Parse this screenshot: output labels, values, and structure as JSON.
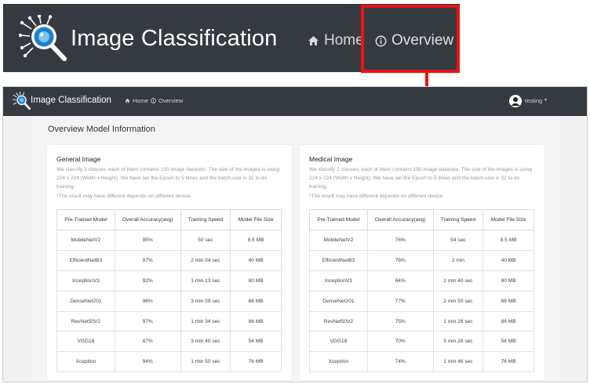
{
  "banner": {
    "title": "Image Classification",
    "nav_home": "Home",
    "nav_overview": "Overview"
  },
  "topbar": {
    "title": "Image Classification",
    "nav_home": "Home",
    "nav_overview": "Overview",
    "username": "testing"
  },
  "page": {
    "title": "Overview Model Information"
  },
  "columns": [
    "Pre-Trained Model",
    "Overall Accuracy(avg)",
    "Training Speed",
    "Model File Size"
  ],
  "general": {
    "title": "General Image",
    "desc": "We classify 2 classes, each of them contains 150 image datasets. The size of the images is using 224 x 224 (Width x Height). We have set the Epoch to 5 times and the batch-size is 32 to do training.",
    "note": "*The result may have different depends on different device.",
    "rows": [
      [
        "MobileNetV2",
        "95%",
        "50 sec",
        "8.5 MB"
      ],
      [
        "EfficientNetB3",
        "97%",
        "2 min 04 sec",
        "40 MB"
      ],
      [
        "InceptionV3",
        "92%",
        "1 min 13 sec",
        "80 MB"
      ],
      [
        "DenseNet201",
        "96%",
        "3 min 09 sec",
        "68 MB"
      ],
      [
        "ResNet50V2",
        "97%",
        "1 min 34 sec",
        "86 MB"
      ],
      [
        "VGG16",
        "87%",
        "3 min 40 sec",
        "54 MB"
      ],
      [
        "Xception",
        "94%",
        "1 min 50 sec",
        "76 MB"
      ]
    ]
  },
  "medical": {
    "title": "Medical Image",
    "desc": "We classify 2 classes, each of them contains 150 image datasets. The size of the images is using 224 x 224 (Width x Height). We have set the Epoch to 5 times and the batch-size is 32 to do training.",
    "note": "*The result may have different depends on different device.",
    "rows": [
      [
        "MobileNetV2",
        "76%",
        "54 sec",
        "8.5 MB"
      ],
      [
        "EfficientNetB3",
        "76%",
        "2 min",
        "40 MB"
      ],
      [
        "InceptionV3",
        "64%",
        "1 min 40 sec",
        "80 MB"
      ],
      [
        "DenseNet201",
        "77%",
        "2 min 50 sec",
        "68 MB"
      ],
      [
        "ResNet50V2",
        "75%",
        "1 min 28 sec",
        "86 MB"
      ],
      [
        "VGG16",
        "70%",
        "3 min 28 sec",
        "54 MB"
      ],
      [
        "Xception",
        "74%",
        "1 min 46 sec",
        "76 MB"
      ]
    ]
  },
  "colors": {
    "navbar": "#343a40",
    "highlight": "#ee1111",
    "logo_blue": "#2e8fd6"
  },
  "icons": {
    "logo": "magnifier-circuit-logo-icon",
    "home": "home-icon",
    "overview": "info-circle-icon",
    "avatar": "user-avatar-icon",
    "caret": "chevron-down-icon"
  }
}
